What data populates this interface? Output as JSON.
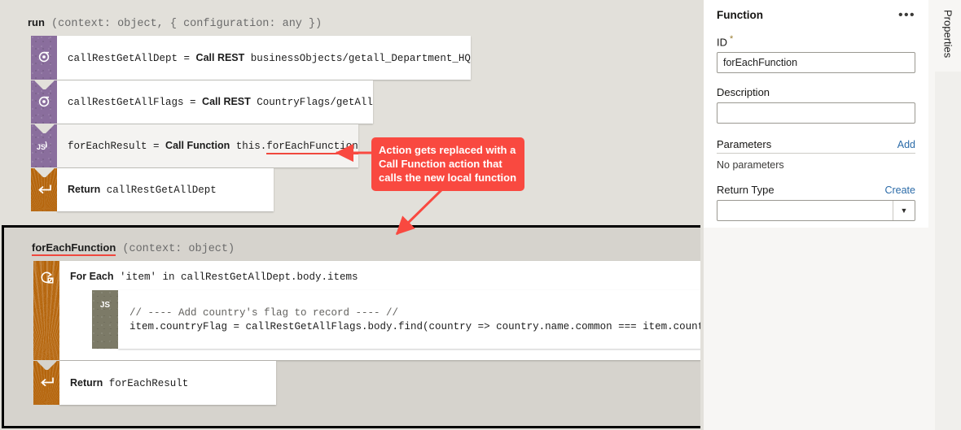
{
  "main_flow": {
    "signature_name": "run",
    "signature_params": " (context: object, { configuration: any })",
    "actions": [
      {
        "icon": "rest-call-icon",
        "var": "callRestGetAllDept",
        "eq": " = ",
        "kind": "Call REST",
        "target": " businessObjects/getall_Department_HQ"
      },
      {
        "icon": "rest-call-icon",
        "var": "callRestGetAllFlags",
        "eq": " = ",
        "kind": "Call REST",
        "target": " CountryFlags/getAll"
      },
      {
        "icon": "js-function-icon",
        "var": "forEachResult",
        "eq": " = ",
        "kind": "Call Function",
        "target_prefix": " this.",
        "target_underlined": "forEachFunction"
      },
      {
        "icon": "return-icon",
        "kind": "Return",
        "target": " callRestGetAllDept"
      }
    ]
  },
  "callout": {
    "text": "Action gets replaced with a Call Function action that calls the new local function",
    "color": "#f94940"
  },
  "fn_panel": {
    "signature_name": "forEachFunction",
    "signature_params": " (context: object)",
    "foreach": {
      "icon": "for-each-icon",
      "kind": "For Each",
      "target": " 'item' in callRestGetAllDept.body.items"
    },
    "js_block": {
      "icon": "js-icon",
      "badge": "JS",
      "line1": "// ---- Add country's flag to record ---- //",
      "line2": "item.countryFlag = callRestGetAllFlags.body.find(country => country.name.common === item.country)?.flags.png;"
    },
    "return": {
      "icon": "return-icon",
      "kind": "Return",
      "target": " forEachResult"
    }
  },
  "properties": {
    "vertical_tab": "Properties",
    "title": "Function",
    "menu_icon": "•••",
    "id_label": "ID",
    "id_required": "*",
    "id_value": "forEachFunction",
    "description_label": "Description",
    "description_value": "",
    "parameters_label": "Parameters",
    "parameters_add": "Add",
    "parameters_empty": "No parameters",
    "return_type_label": "Return Type",
    "return_type_create": "Create",
    "return_type_value": "",
    "return_type_arrow": "▼"
  }
}
